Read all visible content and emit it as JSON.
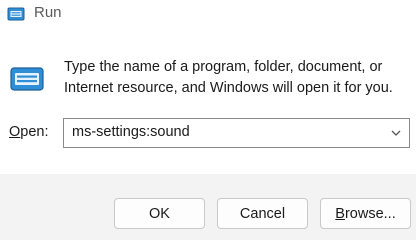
{
  "window": {
    "title": "Run",
    "icon": "run-icon"
  },
  "content": {
    "icon": "run-icon",
    "message": "Type the name of a program, folder, document, or Internet resource, and Windows will open it for you.",
    "open_label_accel": "O",
    "open_label_rest": "pen:",
    "combo_value": "ms-settings:sound"
  },
  "buttons": {
    "ok": "OK",
    "cancel": "Cancel",
    "browse_accel": "B",
    "browse_rest": "rowse..."
  },
  "colors": {
    "accent": "#0067c0",
    "background": "#f3f3f3"
  }
}
